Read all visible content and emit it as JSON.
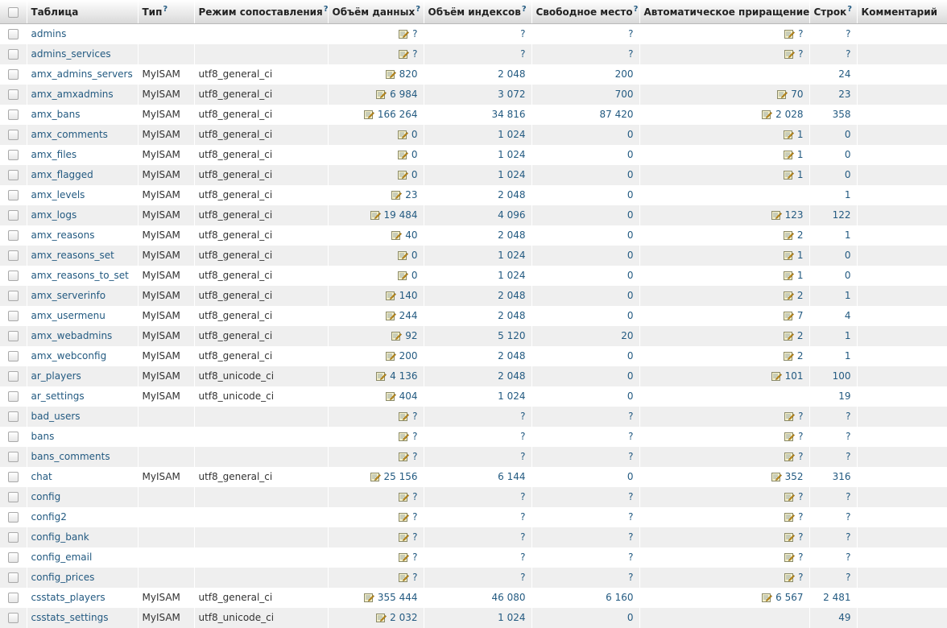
{
  "columns": [
    "Таблица",
    "Тип",
    "Режим сопоставления",
    "Объём данных",
    "Объём индексов",
    "Свободное место",
    "Автоматическое приращение",
    "Строк",
    "Комментарий"
  ],
  "help_marker": "?",
  "icons": {
    "checkbox": "checkbox-icon",
    "edit": "edit-icon"
  },
  "rows": [
    {
      "name": "admins",
      "type": "",
      "collation": "",
      "data": "?",
      "index": "?",
      "free": "?",
      "auto": "?",
      "rows": "?"
    },
    {
      "name": "admins_services",
      "type": "",
      "collation": "",
      "data": "?",
      "index": "?",
      "free": "?",
      "auto": "?",
      "rows": "?"
    },
    {
      "name": "amx_admins_servers",
      "type": "MyISAM",
      "collation": "utf8_general_ci",
      "data": "820",
      "index": "2 048",
      "free": "200",
      "auto": "",
      "rows": "24"
    },
    {
      "name": "amx_amxadmins",
      "type": "MyISAM",
      "collation": "utf8_general_ci",
      "data": "6 984",
      "index": "3 072",
      "free": "700",
      "auto": "70",
      "rows": "23"
    },
    {
      "name": "amx_bans",
      "type": "MyISAM",
      "collation": "utf8_general_ci",
      "data": "166 264",
      "index": "34 816",
      "free": "87 420",
      "auto": "2 028",
      "rows": "358"
    },
    {
      "name": "amx_comments",
      "type": "MyISAM",
      "collation": "utf8_general_ci",
      "data": "0",
      "index": "1 024",
      "free": "0",
      "auto": "1",
      "rows": "0"
    },
    {
      "name": "amx_files",
      "type": "MyISAM",
      "collation": "utf8_general_ci",
      "data": "0",
      "index": "1 024",
      "free": "0",
      "auto": "1",
      "rows": "0"
    },
    {
      "name": "amx_flagged",
      "type": "MyISAM",
      "collation": "utf8_general_ci",
      "data": "0",
      "index": "1 024",
      "free": "0",
      "auto": "1",
      "rows": "0"
    },
    {
      "name": "amx_levels",
      "type": "MyISAM",
      "collation": "utf8_general_ci",
      "data": "23",
      "index": "2 048",
      "free": "0",
      "auto": "",
      "rows": "1"
    },
    {
      "name": "amx_logs",
      "type": "MyISAM",
      "collation": "utf8_general_ci",
      "data": "19 484",
      "index": "4 096",
      "free": "0",
      "auto": "123",
      "rows": "122"
    },
    {
      "name": "amx_reasons",
      "type": "MyISAM",
      "collation": "utf8_general_ci",
      "data": "40",
      "index": "2 048",
      "free": "0",
      "auto": "2",
      "rows": "1"
    },
    {
      "name": "amx_reasons_set",
      "type": "MyISAM",
      "collation": "utf8_general_ci",
      "data": "0",
      "index": "1 024",
      "free": "0",
      "auto": "1",
      "rows": "0"
    },
    {
      "name": "amx_reasons_to_set",
      "type": "MyISAM",
      "collation": "utf8_general_ci",
      "data": "0",
      "index": "1 024",
      "free": "0",
      "auto": "1",
      "rows": "0"
    },
    {
      "name": "amx_serverinfo",
      "type": "MyISAM",
      "collation": "utf8_general_ci",
      "data": "140",
      "index": "2 048",
      "free": "0",
      "auto": "2",
      "rows": "1"
    },
    {
      "name": "amx_usermenu",
      "type": "MyISAM",
      "collation": "utf8_general_ci",
      "data": "244",
      "index": "2 048",
      "free": "0",
      "auto": "7",
      "rows": "4"
    },
    {
      "name": "amx_webadmins",
      "type": "MyISAM",
      "collation": "utf8_general_ci",
      "data": "92",
      "index": "5 120",
      "free": "20",
      "auto": "2",
      "rows": "1"
    },
    {
      "name": "amx_webconfig",
      "type": "MyISAM",
      "collation": "utf8_general_ci",
      "data": "200",
      "index": "2 048",
      "free": "0",
      "auto": "2",
      "rows": "1"
    },
    {
      "name": "ar_players",
      "type": "MyISAM",
      "collation": "utf8_unicode_ci",
      "data": "4 136",
      "index": "2 048",
      "free": "0",
      "auto": "101",
      "rows": "100"
    },
    {
      "name": "ar_settings",
      "type": "MyISAM",
      "collation": "utf8_unicode_ci",
      "data": "404",
      "index": "1 024",
      "free": "0",
      "auto": "",
      "rows": "19"
    },
    {
      "name": "bad_users",
      "type": "",
      "collation": "",
      "data": "?",
      "index": "?",
      "free": "?",
      "auto": "?",
      "rows": "?"
    },
    {
      "name": "bans",
      "type": "",
      "collation": "",
      "data": "?",
      "index": "?",
      "free": "?",
      "auto": "?",
      "rows": "?"
    },
    {
      "name": "bans_comments",
      "type": "",
      "collation": "",
      "data": "?",
      "index": "?",
      "free": "?",
      "auto": "?",
      "rows": "?"
    },
    {
      "name": "chat",
      "type": "MyISAM",
      "collation": "utf8_general_ci",
      "data": "25 156",
      "index": "6 144",
      "free": "0",
      "auto": "352",
      "rows": "316"
    },
    {
      "name": "config",
      "type": "",
      "collation": "",
      "data": "?",
      "index": "?",
      "free": "?",
      "auto": "?",
      "rows": "?"
    },
    {
      "name": "config2",
      "type": "",
      "collation": "",
      "data": "?",
      "index": "?",
      "free": "?",
      "auto": "?",
      "rows": "?"
    },
    {
      "name": "config_bank",
      "type": "",
      "collation": "",
      "data": "?",
      "index": "?",
      "free": "?",
      "auto": "?",
      "rows": "?"
    },
    {
      "name": "config_email",
      "type": "",
      "collation": "",
      "data": "?",
      "index": "?",
      "free": "?",
      "auto": "?",
      "rows": "?"
    },
    {
      "name": "config_prices",
      "type": "",
      "collation": "",
      "data": "?",
      "index": "?",
      "free": "?",
      "auto": "?",
      "rows": "?"
    },
    {
      "name": "csstats_players",
      "type": "MyISAM",
      "collation": "utf8_general_ci",
      "data": "355 444",
      "index": "46 080",
      "free": "6 160",
      "auto": "6 567",
      "rows": "2 481"
    },
    {
      "name": "csstats_settings",
      "type": "MyISAM",
      "collation": "utf8_unicode_ci",
      "data": "2 032",
      "index": "1 024",
      "free": "0",
      "auto": "",
      "rows": "49"
    }
  ]
}
